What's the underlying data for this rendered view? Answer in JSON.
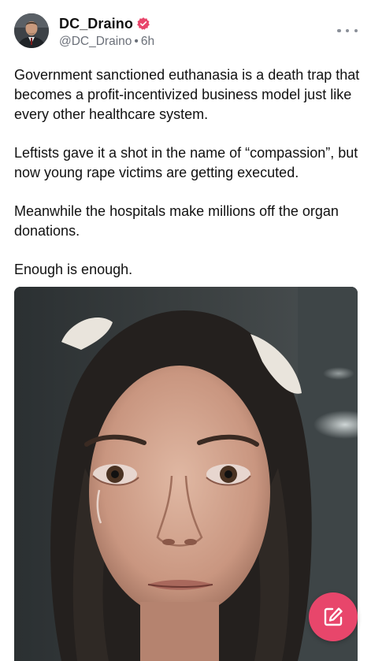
{
  "post": {
    "author": {
      "display_name": "DC_Draino",
      "handle": "@DC_Draino",
      "separator": "•",
      "time_ago": "6h",
      "verified": true
    },
    "text_paragraphs": [
      "Government sanctioned euthanasia is a death trap that becomes a profit-incentivized business model just like every other healthcare system.",
      "Leftists gave it a shot in the name of “compassion”, but now young rape victims are getting executed.",
      "Meanwhile the hospitals make millions off the organ donations.",
      "Enough is enough."
    ]
  },
  "icons": {
    "verified": "verified-badge-icon",
    "more": "more-options-icon",
    "compose": "compose-icon"
  },
  "colors": {
    "accent": "#e8466b",
    "secondary_text": "#6b7079",
    "primary_text": "#111111",
    "background": "#ffffff"
  }
}
